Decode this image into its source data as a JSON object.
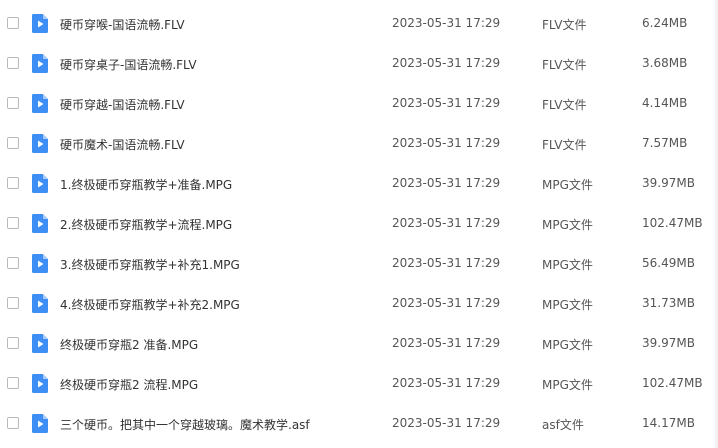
{
  "colors": {
    "icon_blue": "#3d8ef5",
    "icon_fold": "#a9cdfb",
    "text": "#333333",
    "muted_text": "#555555"
  },
  "icons": {
    "file": "video-file-icon"
  },
  "files": [
    {
      "name": "硬币穿喉-国语流畅.FLV",
      "date": "2023-05-31 17:29",
      "type": "FLV文件",
      "size": "6.24MB"
    },
    {
      "name": "硬币穿桌子-国语流畅.FLV",
      "date": "2023-05-31 17:29",
      "type": "FLV文件",
      "size": "3.68MB"
    },
    {
      "name": "硬币穿越-国语流畅.FLV",
      "date": "2023-05-31 17:29",
      "type": "FLV文件",
      "size": "4.14MB"
    },
    {
      "name": "硬币魔术-国语流畅.FLV",
      "date": "2023-05-31 17:29",
      "type": "FLV文件",
      "size": "7.57MB"
    },
    {
      "name": "1.终极硬币穿瓶教学+准备.MPG",
      "date": "2023-05-31 17:29",
      "type": "MPG文件",
      "size": "39.97MB"
    },
    {
      "name": "2.终极硬币穿瓶教学+流程.MPG",
      "date": "2023-05-31 17:29",
      "type": "MPG文件",
      "size": "102.47MB"
    },
    {
      "name": "3.终极硬币穿瓶教学+补充1.MPG",
      "date": "2023-05-31 17:29",
      "type": "MPG文件",
      "size": "56.49MB"
    },
    {
      "name": "4.终极硬币穿瓶教学+补充2.MPG",
      "date": "2023-05-31 17:29",
      "type": "MPG文件",
      "size": "31.73MB"
    },
    {
      "name": "终极硬币穿瓶2 准备.MPG",
      "date": "2023-05-31 17:29",
      "type": "MPG文件",
      "size": "39.97MB"
    },
    {
      "name": "终极硬币穿瓶2 流程.MPG",
      "date": "2023-05-31 17:29",
      "type": "MPG文件",
      "size": "102.47MB"
    },
    {
      "name": "三个硬币。把其中一个穿越玻璃。魔术教学.asf",
      "date": "2023-05-31 17:29",
      "type": "asf文件",
      "size": "14.17MB"
    }
  ]
}
